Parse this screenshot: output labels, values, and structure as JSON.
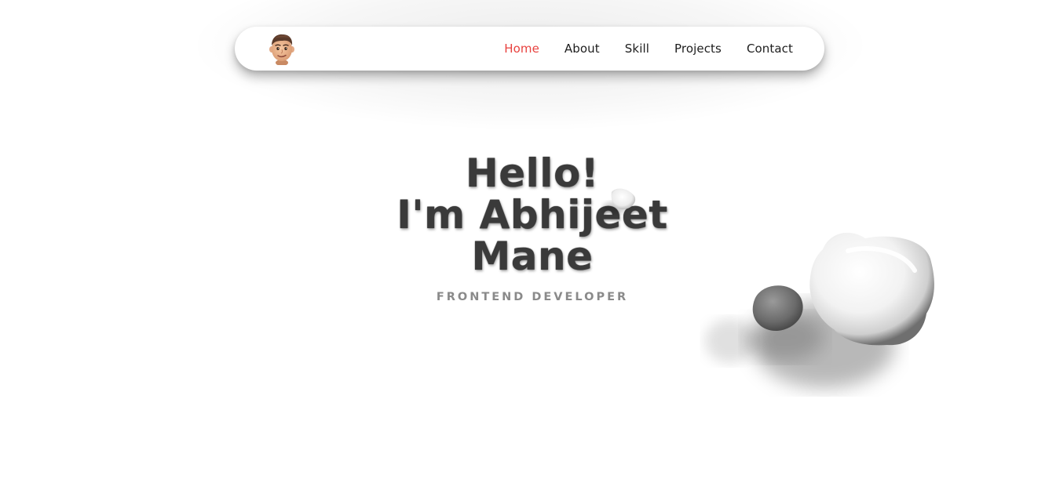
{
  "nav": {
    "avatar_icon": "memoji-avatar-icon",
    "links": [
      {
        "label": "Home",
        "active": true
      },
      {
        "label": "About",
        "active": false
      },
      {
        "label": "Skill",
        "active": false
      },
      {
        "label": "Projects",
        "active": false
      },
      {
        "label": "Contact",
        "active": false
      }
    ],
    "active_color": "#e8423f"
  },
  "hero": {
    "line1": "Hello!",
    "line2": "I'm Abhijeet",
    "line3": "Mane",
    "subtitle": "FRONTEND DEVELOPER"
  },
  "decoration": {
    "icon": "abstract-blob-shapes-icon"
  }
}
